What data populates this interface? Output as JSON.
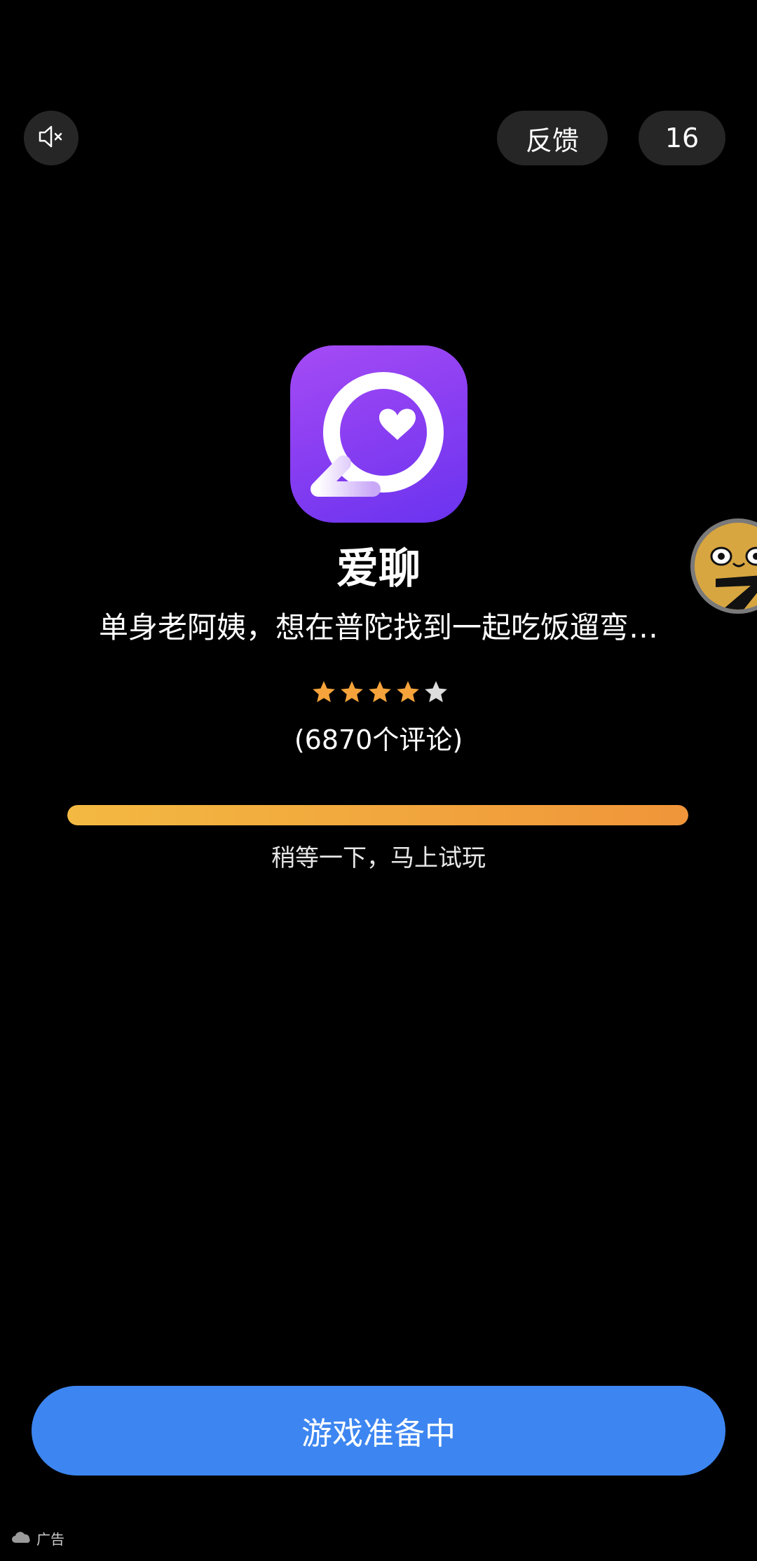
{
  "top_bar": {
    "mute_icon": "speaker-muted-icon",
    "feedback_label": "反馈",
    "countdown": "16"
  },
  "app": {
    "icon": "chat-bubble-heart-icon",
    "name": "爱聊",
    "description": "单身老阿姨，想在普陀找到一起吃饭遛弯…",
    "rating_stars_filled": 4,
    "rating_stars_total": 5,
    "reviews": "(6870个评论)"
  },
  "progress": {
    "fraction": 1.0,
    "text": "稍等一下，马上试玩"
  },
  "cta": {
    "label": "游戏准备中"
  },
  "ad": {
    "label": "广告",
    "icon": "cloud-icon"
  },
  "colors": {
    "background": "#000000",
    "accent_blue": "#3d86f1",
    "progress_start": "#f3b941",
    "progress_end": "#f0953a",
    "star_filled": "#f5a33a",
    "star_empty": "#dddddd",
    "icon_gradient_top": "#a54bf5",
    "icon_gradient_bottom": "#6a33ef"
  }
}
